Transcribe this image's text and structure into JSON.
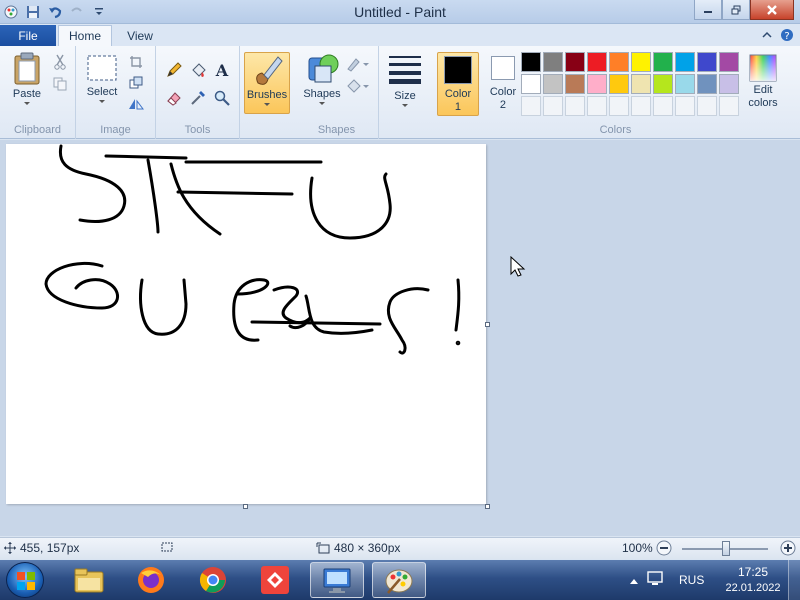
{
  "window": {
    "title": "Untitled - Paint"
  },
  "tabs": {
    "file": "File",
    "home": "Home",
    "view": "View"
  },
  "ribbon": {
    "clipboard": {
      "paste": "Paste",
      "label": "Clipboard"
    },
    "image": {
      "select": "Select",
      "label": "Image"
    },
    "tools": {
      "label": "Tools"
    },
    "brushes": "Brushes",
    "shapes": {
      "shapes": "Shapes",
      "label": "Shapes"
    },
    "size": "Size",
    "colors": {
      "color1": "Color\n1",
      "color2": "Color\n2",
      "edit": "Edit\ncolors",
      "label": "Colors",
      "color1_value": "#000000",
      "color2_value": "#ffffff",
      "palette": [
        "#000000",
        "#7f7f7f",
        "#880015",
        "#ed1c24",
        "#ff7f27",
        "#fff200",
        "#22b14c",
        "#00a2e8",
        "#3f48cc",
        "#a349a4",
        "#ffffff",
        "#c3c3c3",
        "#b97a57",
        "#ffaec9",
        "#ffc90e",
        "#efe4b0",
        "#b5e61d",
        "#99d9ea",
        "#7092be",
        "#c8bfe7",
        "",
        "",
        "",
        "",
        "",
        "",
        "",
        "",
        "",
        ""
      ]
    }
  },
  "status": {
    "cursor_pos": "455, 157px",
    "image_size": "480 × 360px",
    "zoom": "100%"
  },
  "taskbar": {
    "tray": {
      "language": "RUS",
      "time": "17:25",
      "date": "22.01.2022"
    }
  }
}
